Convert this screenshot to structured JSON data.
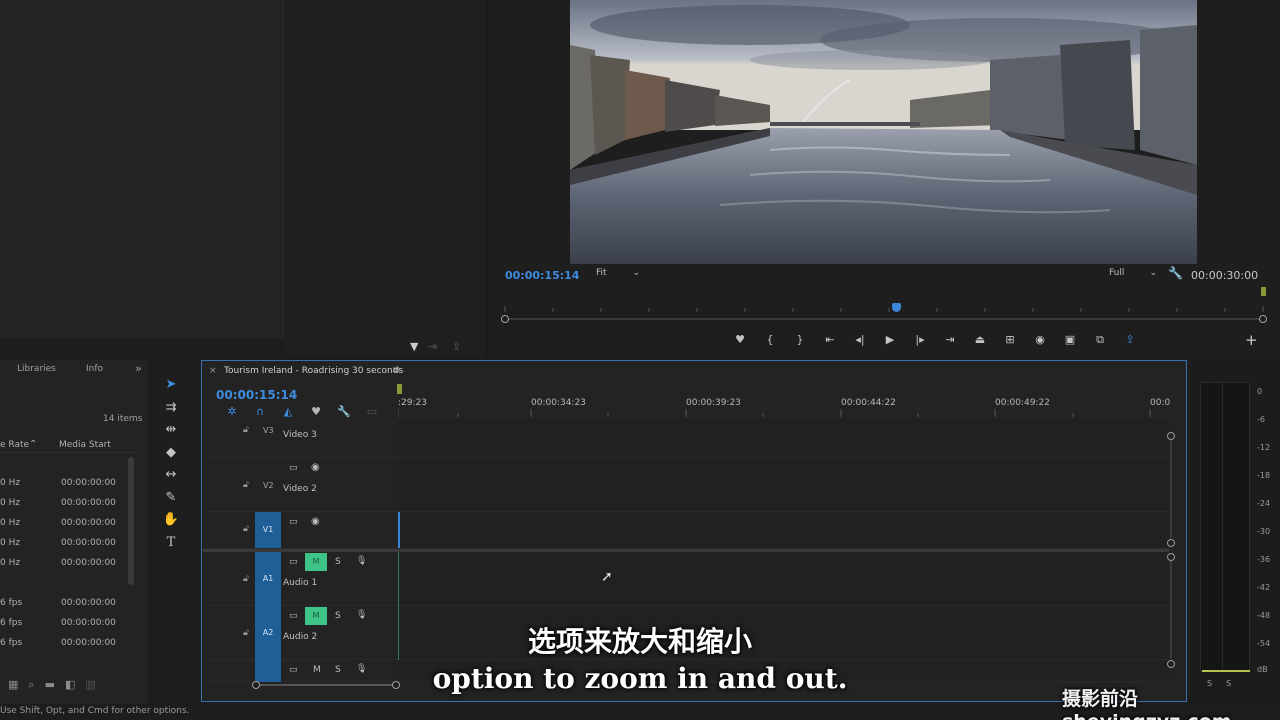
{
  "program_monitor": {
    "current_timecode": "00:00:15:14",
    "fit_label": "Fit",
    "quality_label": "Full",
    "duration_timecode": "00:00:30:00"
  },
  "project_panel": {
    "tabs": [
      "Libraries",
      "Info"
    ],
    "expand_icon": "»",
    "item_count": "14 items",
    "columns": [
      "e Rate",
      "Media Start"
    ],
    "rows": [
      {
        "rate": "0 Hz",
        "start": "00:00:00:00"
      },
      {
        "rate": "0 Hz",
        "start": "00:00:00:00"
      },
      {
        "rate": "0 Hz",
        "start": "00:00:00:00"
      },
      {
        "rate": "0 Hz",
        "start": "00:00:00:00"
      },
      {
        "rate": "0 Hz",
        "start": "00:00:00:00"
      },
      {
        "rate": "6 fps",
        "start": "00:00:00:00"
      },
      {
        "rate": "6 fps",
        "start": "00:00:00:00"
      },
      {
        "rate": "6 fps",
        "start": "00:00:00:00"
      }
    ]
  },
  "timeline": {
    "close_icon": "×",
    "sequence_name": "Tourism Ireland - Roadrising 30 seconds",
    "menu_icon": "≡",
    "current_timecode": "00:00:15:14",
    "ruler_labels": [
      ":29:23",
      "00:00:34:23",
      "00:00:39:23",
      "00:00:44:22",
      "00:00:49:22",
      "00:0"
    ],
    "tracks": {
      "v3": {
        "id": "V3",
        "name": "Video 3"
      },
      "v2": {
        "id": "V2",
        "name": "Video 2"
      },
      "v1": {
        "id": "V1"
      },
      "a1": {
        "id": "A1",
        "name": "Audio 1",
        "mute": "M",
        "solo": "S"
      },
      "a2": {
        "id": "A2",
        "name": "Audio 2",
        "mute": "M",
        "solo": "S"
      },
      "a3": {
        "mute": "M",
        "solo": "S"
      }
    }
  },
  "audio_meter": {
    "scale": [
      "0",
      "-6",
      "-12",
      "-18",
      "-24",
      "-30",
      "-36",
      "-42",
      "-48",
      "-54",
      "dB"
    ],
    "channels": "SS"
  },
  "status_bar": "Use Shift, Opt, and Cmd for other options.",
  "subtitles": {
    "chinese": "选项来放大和缩小",
    "english": "option to zoom in and out."
  },
  "watermark": "摄影前沿 sheyingzyz.com",
  "colors": {
    "accent_blue": "#3e8ce0",
    "mute_green": "#3ec486",
    "track_blue": "#1f5e97"
  }
}
